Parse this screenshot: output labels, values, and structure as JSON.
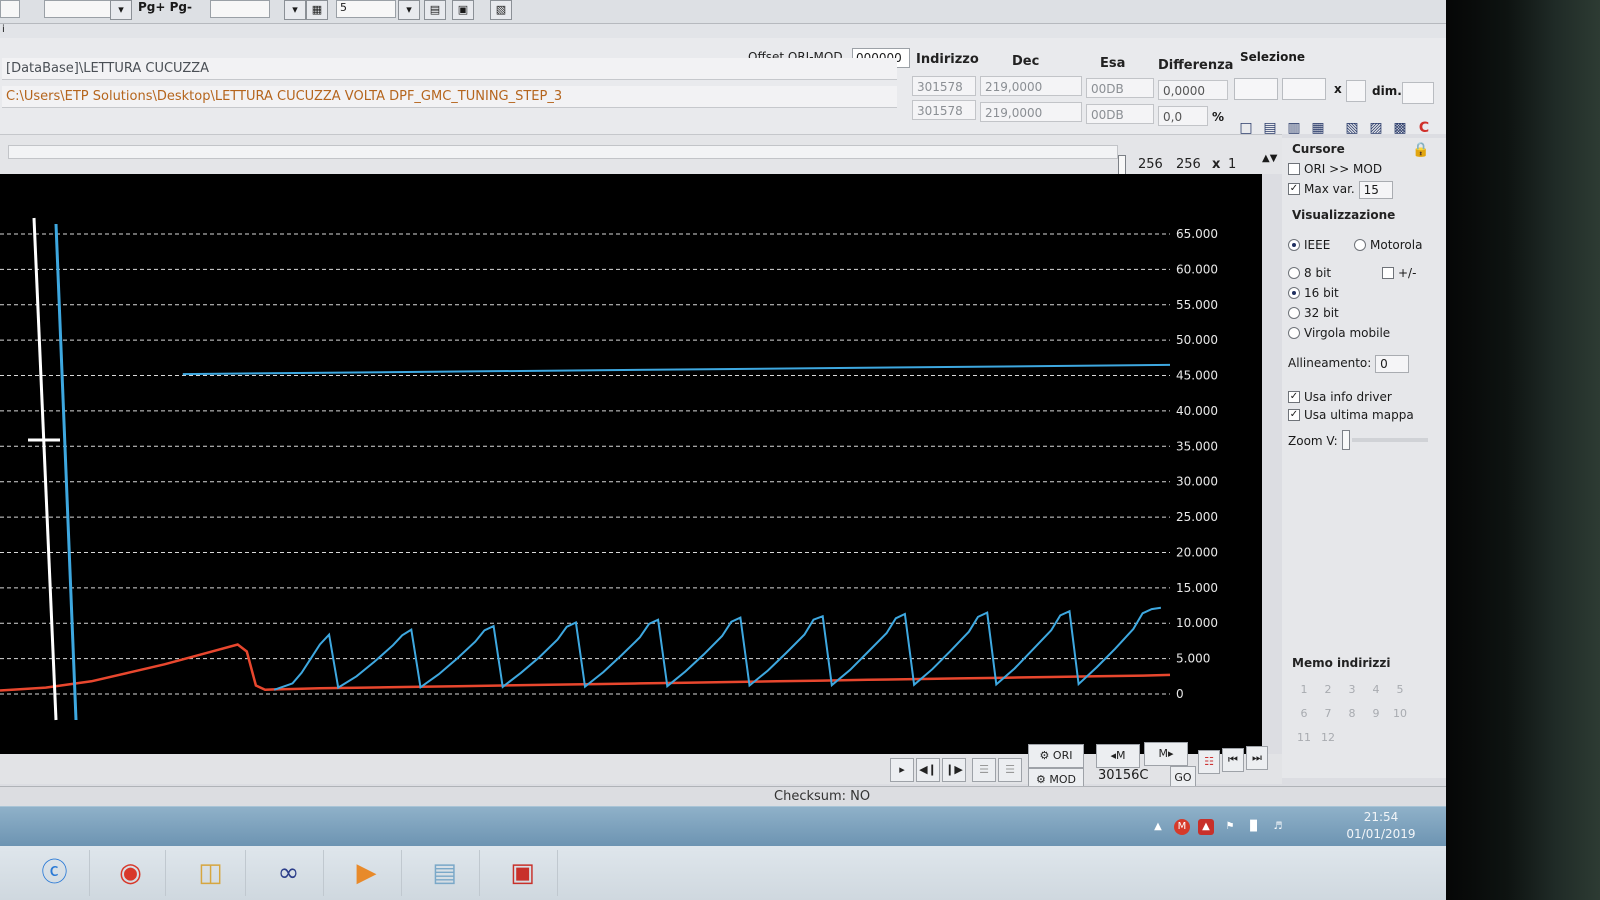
{
  "toolbar": {
    "pages_label": "Pg+ Pg-",
    "pages_value": "5"
  },
  "header": {
    "offset_label": "Offset ORI-MOD",
    "offset_value": "000000",
    "columns": {
      "address": "Indirizzo",
      "dec": "Dec",
      "hex": "Esa",
      "diff": "Differenza"
    },
    "db_path": "[DataBase]\\LETTURA CUCUZZA",
    "file_path": "C:\\Users\\ETP Solutions\\Desktop\\LETTURA CUCUZZA VOLTA DPF_GMC_TUNING_STEP_3",
    "row1": {
      "address": "301578",
      "dec": "219,0000",
      "hex": "00DB",
      "diff": "0,0000"
    },
    "row2": {
      "address": "301578",
      "dec": "219,0000",
      "hex": "00DB",
      "diff": "0,0",
      "unit": "%"
    }
  },
  "selection": {
    "title": "Selezione",
    "times": "x",
    "dim_label": "dim."
  },
  "view": {
    "width": "256",
    "height": "256",
    "times": "x",
    "zoom": "1"
  },
  "panel": {
    "cursor_title": "Cursore",
    "ori_mod_label": "ORI >> MOD",
    "max_var_label": "Max var.",
    "max_var_value": "15",
    "display_title": "Visualizzazione",
    "ieee_label": "IEEE",
    "motorola_label": "Motorola",
    "bit8_label": "8 bit",
    "sign_label": "+/-",
    "bit16_label": "16 bit",
    "bit32_label": "32 bit",
    "float_label": "Virgola mobile",
    "align_label": "Allineamento:",
    "align_value": "0",
    "use_driver_label": "Usa info driver",
    "use_last_map_label": "Usa ultima mappa",
    "zoom_v_label": "Zoom V:",
    "memo_title": "Memo indirizzi",
    "memo_slots": [
      "1",
      "2",
      "3",
      "4",
      "5",
      "6",
      "7",
      "8",
      "9",
      "10",
      "11",
      "12"
    ]
  },
  "controls": {
    "ori_label": "ORI",
    "mod_label": "MOD",
    "prev_map": "◂M",
    "next_map": "M▸",
    "address": "30156C",
    "go_label": "GO"
  },
  "status": {
    "checksum": "Checksum: NO"
  },
  "clock": {
    "time": "21:54",
    "date": "01/01/2019"
  },
  "colors": {
    "ori_line": "#e8472e",
    "mod_line": "#3ea8e0",
    "grid": "#d8d8d8"
  },
  "chart_data": {
    "type": "line",
    "y_ticks": [
      "0",
      "5.000",
      "10.000",
      "15.000",
      "20.000",
      "25.000",
      "30.000",
      "35.000",
      "40.000",
      "45.000",
      "50.000",
      "55.000",
      "60.000",
      "65.000"
    ],
    "ylim": [
      0,
      65000
    ],
    "xlim": [
      0,
      256
    ],
    "grid": true,
    "series": [
      {
        "x": [
          0,
          10,
          20,
          28,
          36,
          44,
          52,
          54,
          56,
          58,
          60,
          64,
          70,
          80,
          90,
          100,
          110,
          120,
          130,
          140,
          150,
          160,
          170,
          180,
          190,
          200,
          210,
          220,
          230,
          240,
          250,
          256
        ],
        "y": [
          500,
          900,
          1800,
          3000,
          4200,
          5600,
          7000,
          6000,
          1200,
          600,
          650,
          700,
          800,
          900,
          1000,
          1100,
          1200,
          1300,
          1400,
          1500,
          1600,
          1700,
          1800,
          1900,
          2000,
          2100,
          2200,
          2300,
          2400,
          2500,
          2600,
          2700
        ]
      },
      {
        "x": [
          40,
          256
        ],
        "y": [
          45200,
          46500
        ]
      },
      {
        "x": [
          60,
          64,
          66,
          68,
          70,
          72,
          74,
          78,
          82,
          86,
          88,
          90,
          92,
          96,
          100,
          104,
          106,
          108,
          110,
          114,
          118,
          122,
          124,
          126,
          128,
          132,
          136,
          140,
          142,
          144,
          146,
          150,
          154,
          158,
          160,
          162,
          164,
          168,
          172,
          176,
          178,
          180,
          182,
          186,
          190,
          194,
          196,
          198,
          200,
          204,
          208,
          212,
          214,
          216,
          218,
          222,
          226,
          230,
          232,
          234,
          236,
          240,
          244,
          248,
          250,
          252,
          254
        ],
        "y": [
          600,
          1500,
          3000,
          5000,
          7000,
          8400,
          900,
          2500,
          4600,
          6900,
          8300,
          9100,
          950,
          2800,
          5000,
          7400,
          9000,
          9600,
          1000,
          3000,
          5200,
          7700,
          9500,
          10100,
          1050,
          3100,
          5500,
          8000,
          9900,
          10500,
          1100,
          3200,
          5600,
          8200,
          10200,
          10800,
          1200,
          3300,
          5800,
          8400,
          10500,
          11000,
          1250,
          3400,
          6000,
          8600,
          10700,
          11300,
          1300,
          3500,
          6100,
          8800,
          10900,
          11500,
          1350,
          3600,
          6300,
          9000,
          11100,
          11700,
          1400,
          3800,
          6400,
          9200,
          11400,
          12000,
          12200
        ]
      }
    ]
  }
}
